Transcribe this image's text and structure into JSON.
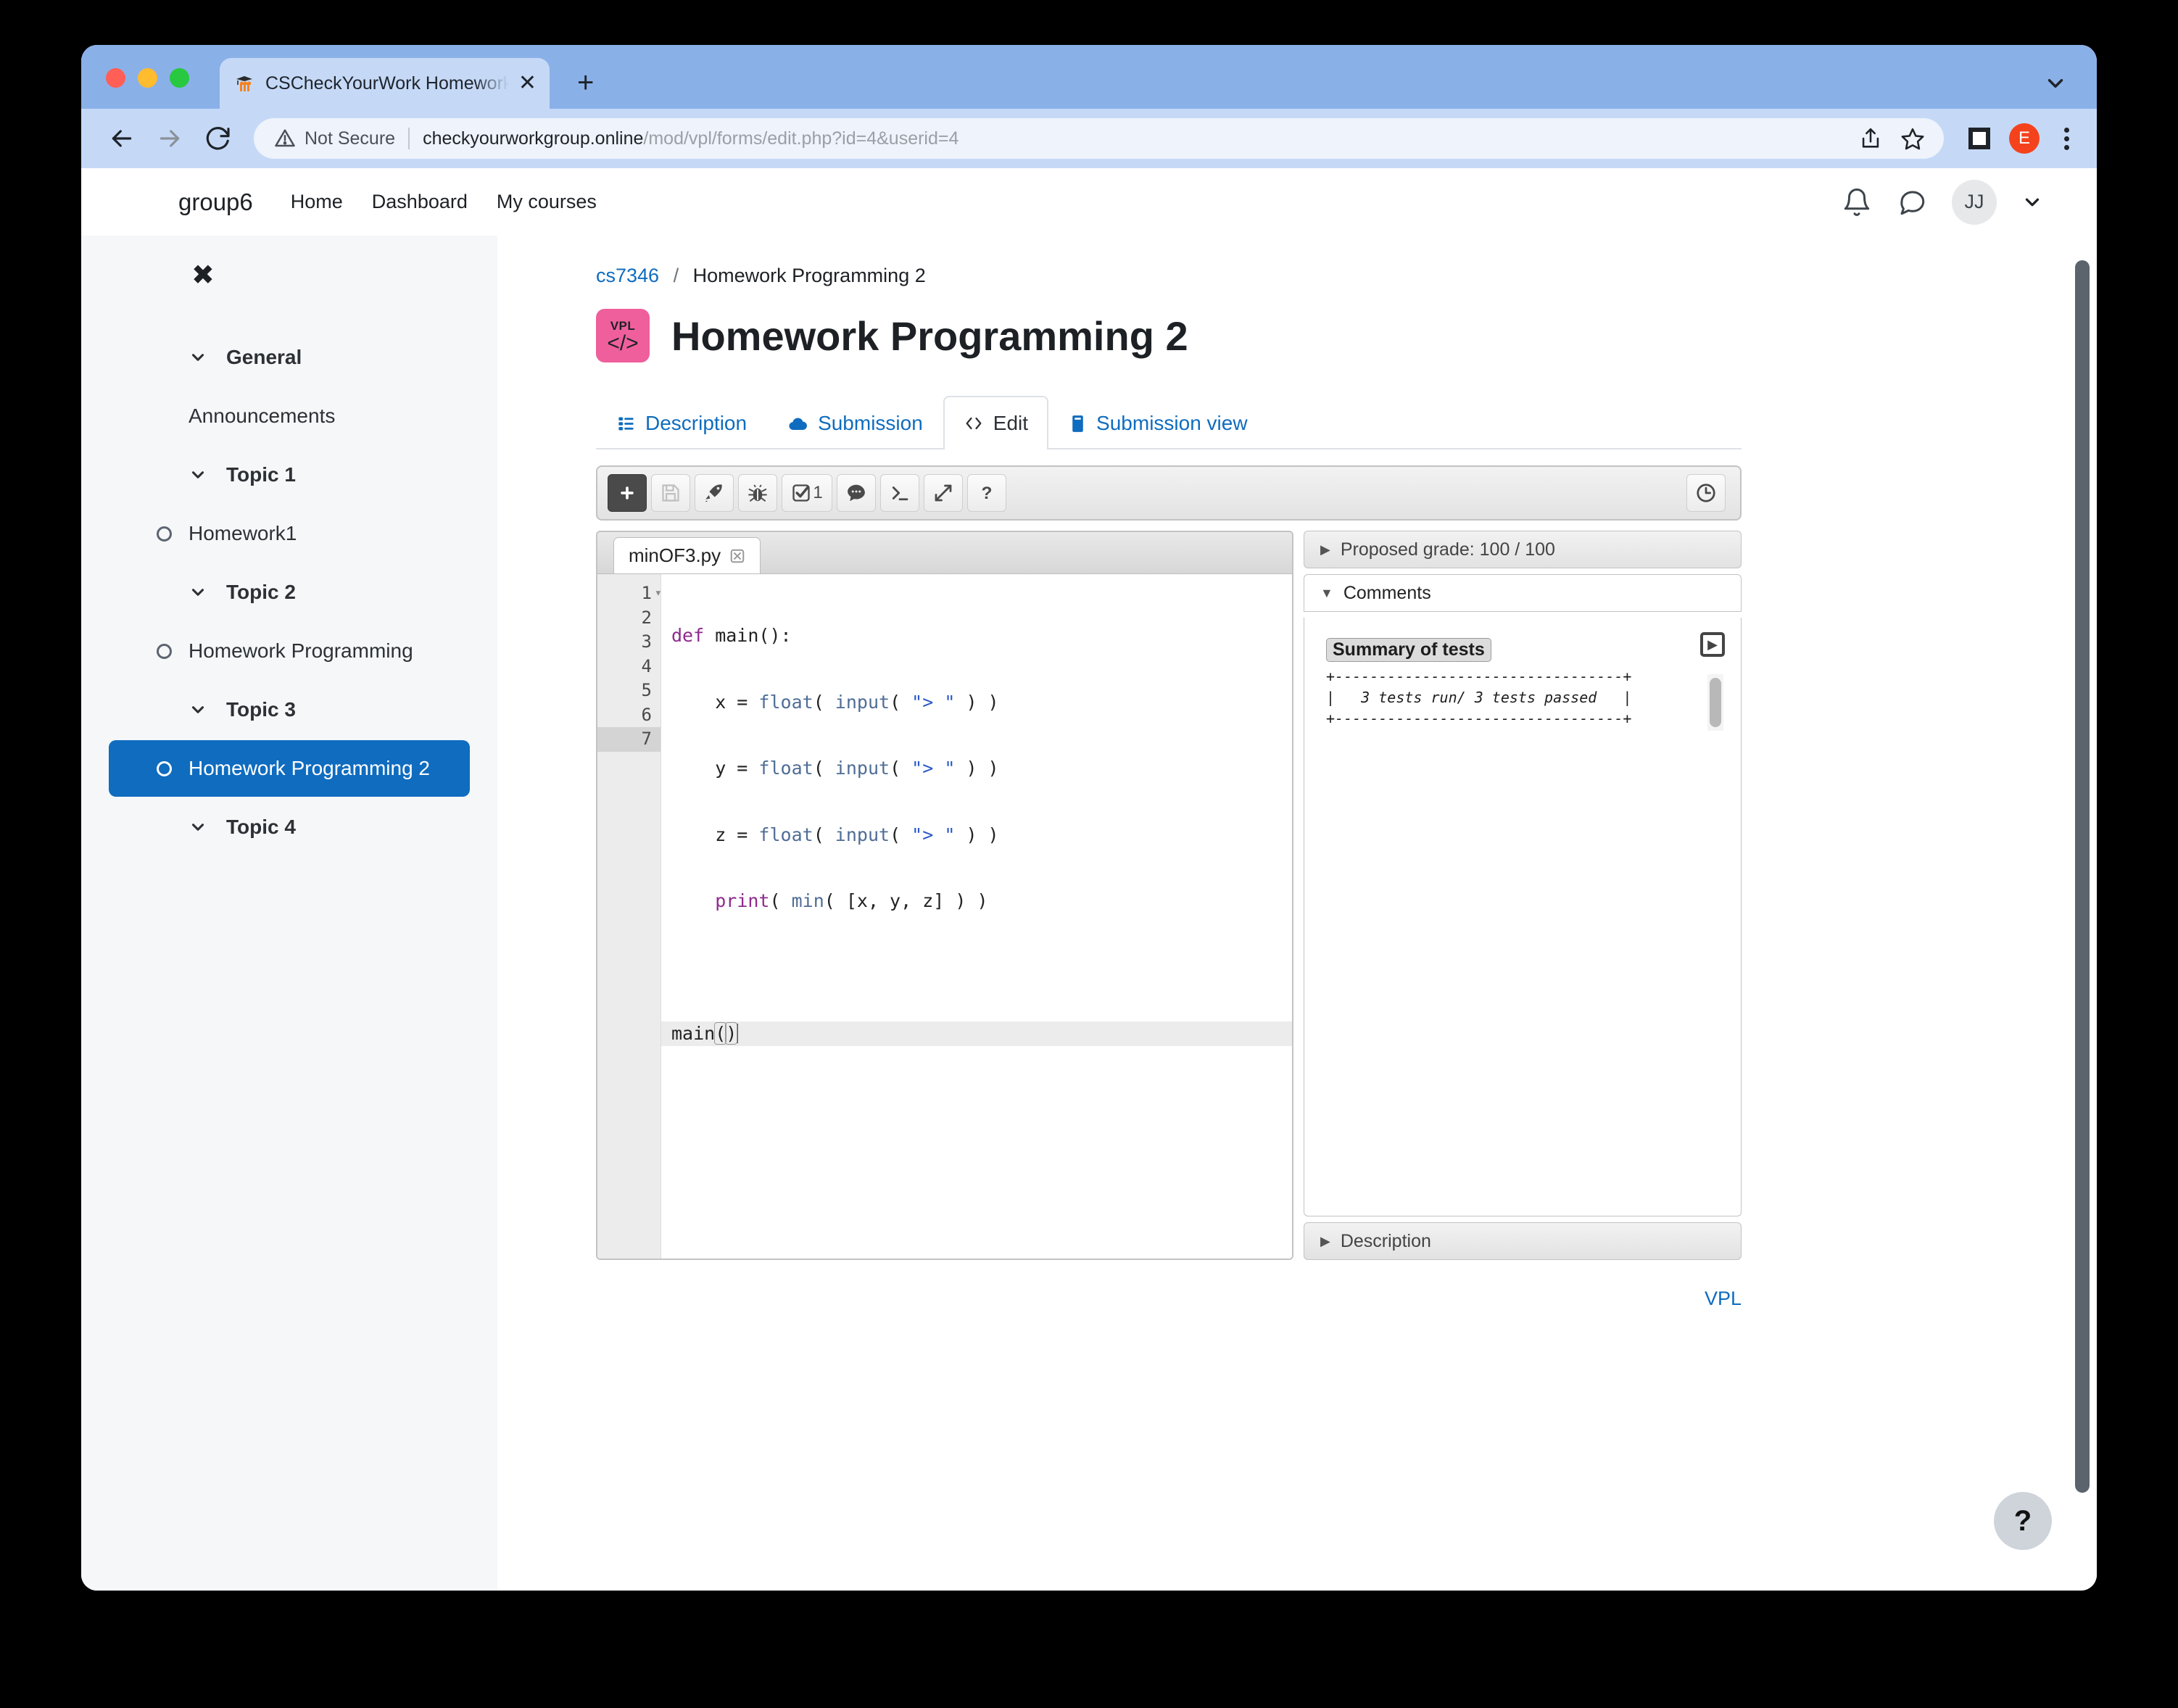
{
  "browser": {
    "tab": {
      "title": "CSCheckYourWork Homework",
      "favicon": "moodle-icon",
      "close_label": "✕"
    },
    "newtab_label": "+",
    "security_label": "Not Secure",
    "url_host": "checkyourworkgroup.online",
    "url_path": "/mod/vpl/forms/edit.php?id=4&userid=4",
    "profile_initial": "E"
  },
  "site": {
    "brand": "group6",
    "nav": [
      {
        "label": "Home"
      },
      {
        "label": "Dashboard"
      },
      {
        "label": "My courses"
      }
    ],
    "user_initials": "JJ"
  },
  "sidebar": {
    "close_label": "✖",
    "items": [
      {
        "label": "General",
        "type": "section"
      },
      {
        "label": "Announcements",
        "type": "plain"
      },
      {
        "label": "Topic 1",
        "type": "section"
      },
      {
        "label": "Homework1",
        "type": "activity"
      },
      {
        "label": "Topic 2",
        "type": "section"
      },
      {
        "label": "Homework Programming",
        "type": "activity"
      },
      {
        "label": "Topic 3",
        "type": "section"
      },
      {
        "label": "Homework Programming 2",
        "type": "activity",
        "active": true
      },
      {
        "label": "Topic 4",
        "type": "section"
      }
    ]
  },
  "main": {
    "breadcrumb": {
      "course": "cs7346",
      "separator": "/",
      "current": "Homework Programming 2"
    },
    "activity_icon_label": "VPL",
    "activity_icon_glyph": "</>",
    "activity_icon_color": "#ef5f9c",
    "title": "Homework Programming 2",
    "tabs": [
      {
        "label": "Description",
        "icon": "description-icon",
        "active": false
      },
      {
        "label": "Submission",
        "icon": "upload-cloud-icon",
        "active": false
      },
      {
        "label": "Edit",
        "icon": "code-icon",
        "active": true
      },
      {
        "label": "Submission view",
        "icon": "submission-view-icon",
        "active": false
      }
    ],
    "footer_link": "VPL"
  },
  "vpl_toolbar": {
    "buttons": [
      {
        "name": "new-file-button",
        "icon": "plus-square-icon",
        "label": ""
      },
      {
        "name": "save-button",
        "icon": "floppy-disk-icon",
        "label": "",
        "disabled": true
      },
      {
        "name": "run-button",
        "icon": "rocket-icon",
        "label": ""
      },
      {
        "name": "debug-button",
        "icon": "bug-icon",
        "label": ""
      },
      {
        "name": "evaluate-button",
        "icon": "check-square-icon",
        "label": "1"
      },
      {
        "name": "comments-button",
        "icon": "speech-bubble-icon",
        "label": ""
      },
      {
        "name": "console-button",
        "icon": "terminal-icon",
        "label": ""
      },
      {
        "name": "fullscreen-button",
        "icon": "expand-arrows-icon",
        "label": ""
      },
      {
        "name": "help-button",
        "icon": "question-mark-icon",
        "label": ""
      }
    ],
    "history_button": {
      "name": "history-button",
      "icon": "clock-icon"
    }
  },
  "editor": {
    "file_tab": {
      "name": "minOF3.py",
      "close_glyph": "✄"
    },
    "lines": [
      {
        "num": "1",
        "fold": "▾",
        "current": false
      },
      {
        "num": "2",
        "fold": "",
        "current": false
      },
      {
        "num": "3",
        "fold": "",
        "current": false
      },
      {
        "num": "4",
        "fold": "",
        "current": false
      },
      {
        "num": "5",
        "fold": "",
        "current": false
      },
      {
        "num": "6",
        "fold": "",
        "current": false
      },
      {
        "num": "7",
        "fold": "",
        "current": true
      }
    ],
    "code_text": [
      "def main():",
      "    x = float( input( \"> \" ) )",
      "    y = float( input( \"> \" ) )",
      "    z = float( input( \"> \" ) )",
      "    print( min( [x, y, z] ) )",
      "",
      "main()"
    ]
  },
  "side_panel": {
    "grade": {
      "label": "Proposed grade: 100 / 100",
      "expanded": false,
      "tri": "▶"
    },
    "comments": {
      "label": "Comments",
      "expanded": true,
      "tri": "▼"
    },
    "summary_title": "Summary of tests",
    "summary_ascii": "+---------------------------------+\n|   3 tests run/ 3 tests passed   |\n+---------------------------------+",
    "description": {
      "label": "Description",
      "expanded": false,
      "tri": "▶"
    },
    "play_button_label": "▶"
  },
  "help_fab": {
    "label": "?"
  }
}
